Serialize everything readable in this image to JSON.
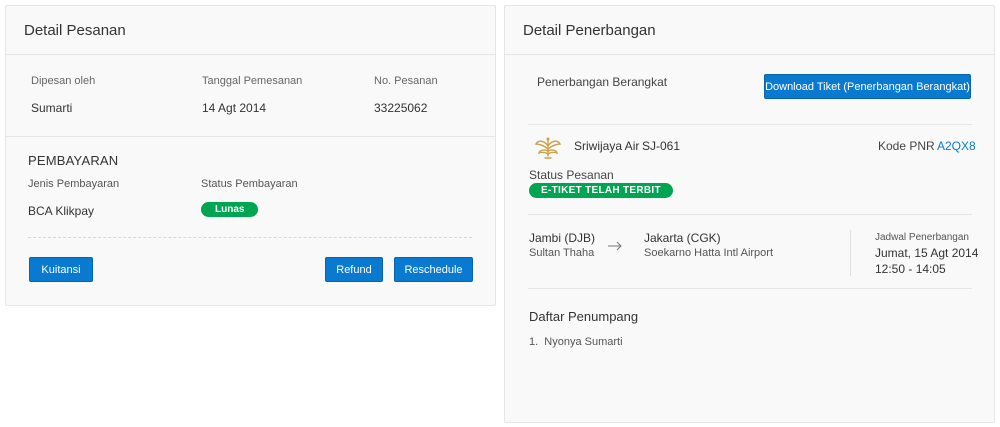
{
  "order_panel": {
    "title": "Detail Pesanan",
    "booked_by_label": "Dipesan oleh",
    "booked_by_value": "Sumarti",
    "order_date_label": "Tanggal Pemesanan",
    "order_date_value": "14 Agt 2014",
    "order_no_label": "No. Pesanan",
    "order_no_value": "33225062",
    "payment_title": "PEMBAYARAN",
    "payment_type_label": "Jenis Pembayaran",
    "payment_type_value": "BCA Klikpay",
    "payment_status_label": "Status Pembayaran",
    "payment_status_value": "Lunas",
    "receipt_button": "Kuitansi",
    "refund_button": "Refund",
    "reschedule_button": "Reschedule"
  },
  "flight_panel": {
    "title": "Detail Penerbangan",
    "section_label": "Penerbangan Berangkat",
    "download_button": "Download Tiket (Penerbangan Berangkat)",
    "airline": "Sriwijaya Air",
    "flight_no": "SJ-061",
    "pnr_label": "Kode PNR",
    "pnr_value": "A2QX8",
    "order_status_label": "Status Pesanan",
    "order_status_value": "E-TIKET TELAH TERBIT",
    "origin_city": "Jambi (DJB)",
    "origin_airport": "Sultan Thaha",
    "dest_city": "Jakarta (CGK)",
    "dest_airport": "Soekarno Hatta Intl Airport",
    "schedule_label": "Jadwal Penerbangan",
    "schedule_date": "Jumat, 15 Agt 2014",
    "schedule_time": "12:50 - 14:05",
    "passengers_title": "Daftar Penumpang",
    "passengers": [
      "1.  Nyonya Sumarti"
    ]
  },
  "colors": {
    "accent_blue": "#0a7ad1",
    "success_green": "#00a551",
    "logo_gold": "#c9a24a"
  },
  "icons": {
    "airline_logo": "sriwijaya-air-logo",
    "route_arrow": "arrow-right-icon"
  }
}
